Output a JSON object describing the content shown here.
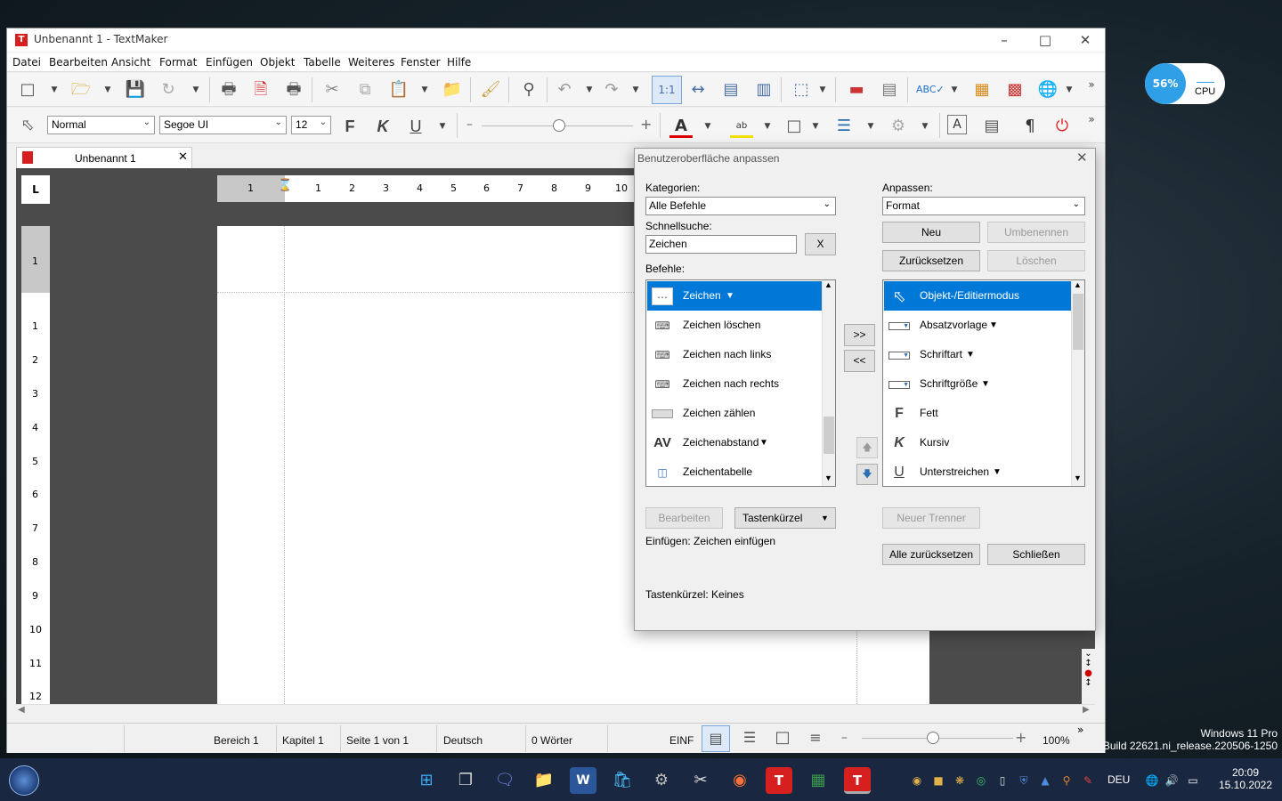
{
  "window": {
    "title": "Unbenannt 1 - TextMaker",
    "app_icon_letter": "T"
  },
  "menubar": [
    "Datei",
    "Bearbeiten",
    "Ansicht",
    "Format",
    "Einfügen",
    "Objekt",
    "Tabelle",
    "Weiteres",
    "Fenster",
    "Hilfe"
  ],
  "formatbar": {
    "style": "Normal",
    "font": "Segoe UI",
    "size": "12",
    "bold": "F",
    "italic": "K",
    "underline": "U"
  },
  "doc_tab": {
    "label": "Unbenannt 1"
  },
  "ruler": {
    "h_ticks": [
      "1",
      "1",
      "2",
      "3",
      "4",
      "5",
      "6",
      "7",
      "8",
      "9",
      "10"
    ],
    "v_ticks": [
      "1",
      "1",
      "2",
      "3",
      "4",
      "5",
      "6",
      "7",
      "8",
      "9",
      "10",
      "11",
      "12"
    ],
    "corner": "L"
  },
  "statusbar": {
    "bereich": "Bereich 1",
    "kapitel": "Kapitel 1",
    "seite": "Seite 1 von 1",
    "sprache": "Deutsch",
    "woerter": "0 Wörter",
    "mode": "EINF",
    "zoom": "100%"
  },
  "dialog": {
    "title": "Benutzeroberfläche anpassen",
    "kategorien_label": "Kategorien:",
    "kategorien_value": "Alle Befehle",
    "schnellsuche_label": "Schnellsuche:",
    "schnellsuche_value": "Zeichen",
    "clear_button": "X",
    "befehle_label": "Befehle:",
    "befehle": [
      {
        "label": "Zeichen",
        "icon": "dots-box",
        "dropdown": true,
        "selected": true
      },
      {
        "label": "Zeichen löschen",
        "icon": "keyboard",
        "dropdown": false
      },
      {
        "label": "Zeichen nach links",
        "icon": "keyboard",
        "dropdown": false
      },
      {
        "label": "Zeichen nach rechts",
        "icon": "keyboard",
        "dropdown": false
      },
      {
        "label": "Zeichen zählen",
        "icon": "gray-box",
        "dropdown": false
      },
      {
        "label": "Zeichenabstand",
        "icon": "AV",
        "dropdown": true
      },
      {
        "label": "Zeichentabelle",
        "icon": "charmap",
        "dropdown": false
      }
    ],
    "add_button": ">>",
    "remove_button": "<<",
    "anpassen_label": "Anpassen:",
    "anpassen_value": "Format",
    "neu_button": "Neu",
    "umbenennen_button": "Umbenennen",
    "zuruecksetzen_button": "Zurücksetzen",
    "loeschen_button": "Löschen",
    "anpassen_items": [
      {
        "label": "Objekt-/Editiermodus",
        "icon": "cursor",
        "dropdown": false,
        "selected": true
      },
      {
        "label": "Absatzvorlage",
        "icon": "combo",
        "dropdown": true
      },
      {
        "label": "Schriftart",
        "icon": "combo",
        "dropdown": true
      },
      {
        "label": "Schriftgröße",
        "icon": "combo",
        "dropdown": true
      },
      {
        "label": "Fett",
        "icon": "F",
        "dropdown": false
      },
      {
        "label": "Kursiv",
        "icon": "K",
        "dropdown": false
      },
      {
        "label": "Unterstreichen",
        "icon": "U",
        "dropdown": true
      }
    ],
    "bearbeiten_button": "Bearbeiten",
    "tastenkuerzel_button": "Tastenkürzel",
    "neuer_trenner_button": "Neuer Trenner",
    "einfuegen_info": "Einfügen: Zeichen einfügen",
    "alle_zuruecksetzen_button": "Alle zurücksetzen",
    "schliessen_button": "Schließen",
    "tastenkuerzel_info": "Tastenkürzel: Keines"
  },
  "cpu_widget": {
    "percent": "56%",
    "label": "CPU"
  },
  "watermark": {
    "line1": "Windows 11 Pro",
    "line2": "Build 22621.ni_release.220506-1250"
  },
  "tray": {
    "lang": "DEU",
    "time": "20:09",
    "date": "15.10.2022"
  }
}
